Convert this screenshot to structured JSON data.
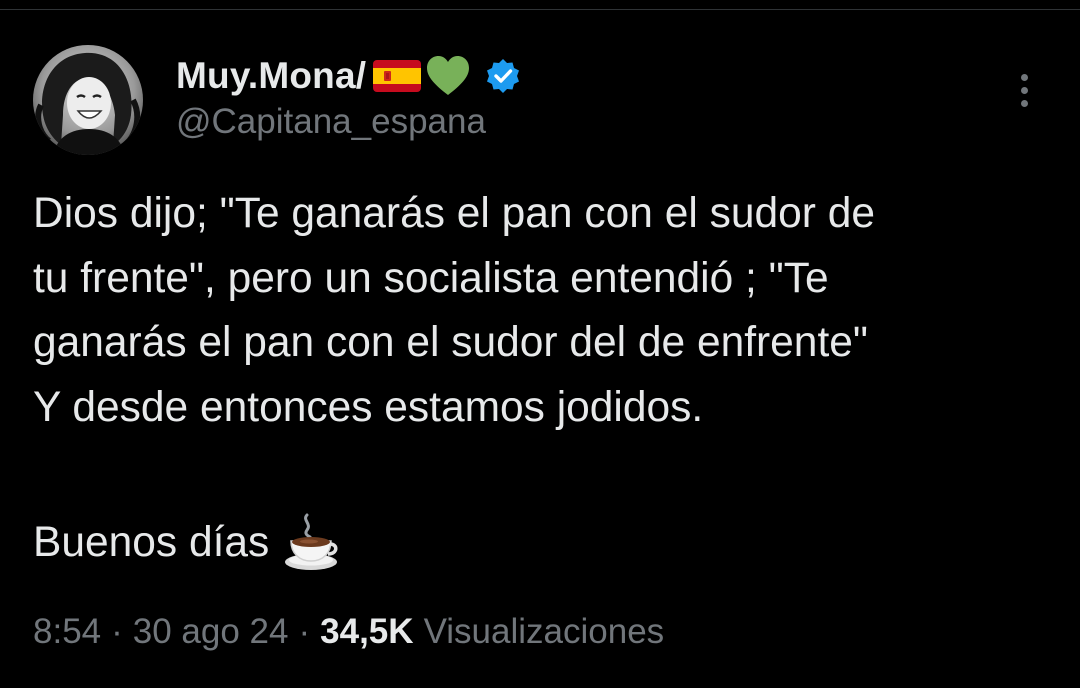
{
  "author": {
    "display_name": "Muy.Mona/",
    "handle": "@Capitana_espana",
    "name_icons": [
      "spain-flag-icon",
      "green-heart-icon"
    ],
    "verified": true,
    "avatar": "profile-photo-avatar"
  },
  "tweet": {
    "lines": [
      "Dios dijo; \"Te ganarás el pan con el sudor de",
      "tu frente\", pero un socialista entendió ; \"Te",
      "ganarás el pan con el sudor del de enfrente\"",
      "Y desde entonces estamos jodidos."
    ],
    "greeting": "Buenos días",
    "greeting_icon": "hot-beverage-icon"
  },
  "meta": {
    "time": "8:54",
    "separator": "·",
    "date": "30 ago 24",
    "views_count": "34,5K",
    "views_label": "Visualizaciones"
  },
  "colors": {
    "background": "#000000",
    "primary_text": "#e7e9ea",
    "secondary_text": "#71767b",
    "verified_blue": "#1d9bf0",
    "heart_green": "#78b159"
  },
  "menu": {
    "icon": "more-options-icon"
  }
}
